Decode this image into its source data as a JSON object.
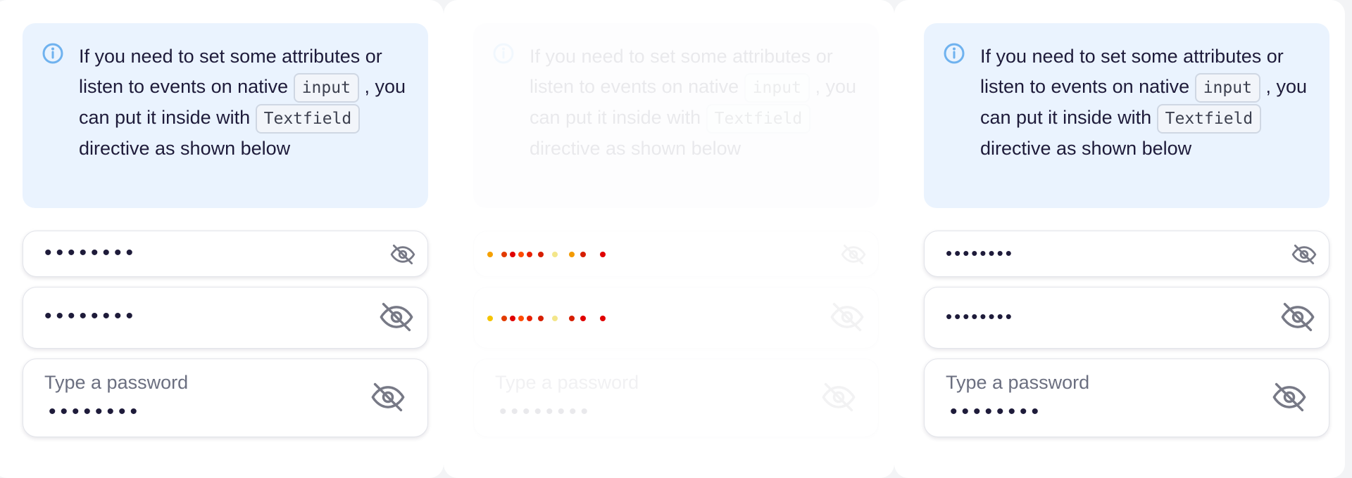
{
  "info": {
    "text_before_code1": "If you need to set some attributes or listen to events on native ",
    "code1": "input",
    "text_after_code1": " , you can put it inside with ",
    "code2": "Textfield",
    "text_after_code2": " directive as shown below"
  },
  "fields": [
    {
      "mask": "••••••••"
    },
    {
      "mask": "••••••••"
    },
    {
      "label": "Type a password",
      "mask": "••••••••"
    }
  ],
  "icons": {
    "info": "info-icon",
    "toggle": "eye-off-icon"
  },
  "colors": {
    "info_bg": "#eaf3fe",
    "info_icon": "#6fb2ef",
    "text": "#1e1b3a",
    "icon": "#777986"
  }
}
